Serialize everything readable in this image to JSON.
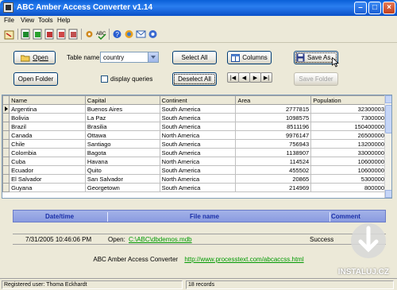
{
  "window": {
    "title": "ABC Amber Access Converter v1.14"
  },
  "menu": [
    "File",
    "View",
    "Tools",
    "Help"
  ],
  "toolbar_icons": [
    "open-icon",
    "excel-icon",
    "word-icon",
    "pdf-icon",
    "html-icon",
    "xml-icon",
    "settings-icon",
    "spellcheck-icon",
    "help-icon",
    "home-icon",
    "mail-icon",
    "about-icon"
  ],
  "controls": {
    "open_label": "Open",
    "table_name_label": "Table name:",
    "table_name_value": "country",
    "select_all_label": "Select All",
    "columns_label": "Columns",
    "save_as_label": "Save As...",
    "open_folder_label": "Open Folder",
    "display_queries_label": "display queries",
    "deselect_all_label": "Deselect All",
    "save_folder_label": "Save Folder"
  },
  "grid": {
    "columns": [
      "Name",
      "Capital",
      "Continent",
      "Area",
      "Population"
    ],
    "rows": [
      [
        "Argentina",
        "Buenos Aires",
        "South America",
        "2777815",
        "32300003"
      ],
      [
        "Bolivia",
        "La Paz",
        "South America",
        "1098575",
        "7300000"
      ],
      [
        "Brazil",
        "Brasilia",
        "South America",
        "8511196",
        "150400000"
      ],
      [
        "Canada",
        "Ottawa",
        "North America",
        "9976147",
        "26500000"
      ],
      [
        "Chile",
        "Santiago",
        "South America",
        "756943",
        "13200000"
      ],
      [
        "Colombia",
        "Bagota",
        "South America",
        "1138907",
        "33000000"
      ],
      [
        "Cuba",
        "Havana",
        "North America",
        "114524",
        "10600000"
      ],
      [
        "Ecuador",
        "Quito",
        "South America",
        "455502",
        "10600000"
      ],
      [
        "El Salvador",
        "San Salvador",
        "North America",
        "20865",
        "5300000"
      ],
      [
        "Guyana",
        "Georgetown",
        "South America",
        "214969",
        "800000"
      ]
    ]
  },
  "log": {
    "headers": {
      "datetime": "Date/time",
      "filename": "File name",
      "comment": "Comment"
    },
    "entry": {
      "datetime": "7/31/2005 10:46:06 PM",
      "action": "Open:",
      "path": "C:\\ABC\\dbdemos.mdb",
      "status": "Success"
    }
  },
  "footer": {
    "app_name": "ABC Amber Access Converter",
    "url": "http://www.processtext.com/abcaccss.html"
  },
  "status": {
    "user": "Registered user: Thoma Eckhardt",
    "records": "18 records"
  },
  "watermark": "INSTALUJ.CZ"
}
